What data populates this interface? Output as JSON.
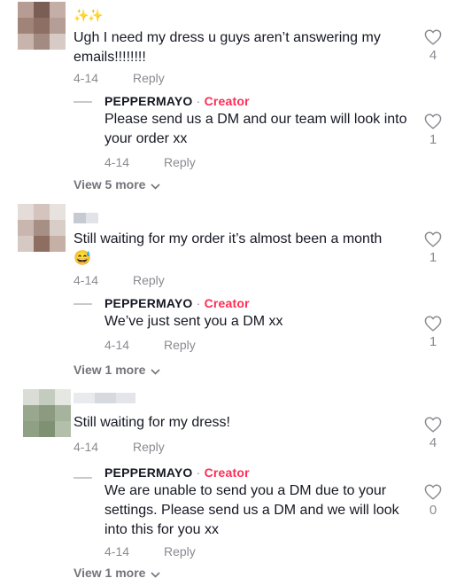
{
  "comments": [
    {
      "prefix_emoji": "✨✨",
      "text": "Ugh I need my dress u guys aren’t answering my emails!!!!!!!!",
      "date": "4-14",
      "reply_label": "Reply",
      "likes": "4",
      "creator_reply": {
        "name": "PEPPERMAYO",
        "separator": "·",
        "badge": "Creator",
        "text": "Please send us a DM and our team will look into your order xx",
        "date": "4-14",
        "reply_label": "Reply",
        "likes": "1"
      },
      "view_more": "View 5 more"
    },
    {
      "text": "Still waiting for my order it’s almost been a month",
      "emoji": "😅",
      "date": "4-14",
      "reply_label": "Reply",
      "likes": "1",
      "creator_reply": {
        "name": "PEPPERMAYO",
        "separator": "·",
        "badge": "Creator",
        "text": "We’ve just sent you a DM xx",
        "date": "4-14",
        "reply_label": "Reply",
        "likes": "1"
      },
      "view_more": "View 1 more"
    },
    {
      "text": "Still waiting for my dress!",
      "date": "4-14",
      "reply_label": "Reply",
      "likes": "4",
      "creator_reply": {
        "name": "PEPPERMAYO",
        "separator": "·",
        "badge": "Creator",
        "text": "We are unable to send you a DM due to your settings. Please send us a DM and we will look into this for you xx",
        "date": "4-14",
        "reply_label": "Reply",
        "likes": "0"
      },
      "view_more": "View 1 more"
    }
  ],
  "colors": {
    "creator_badge": "#fe2c55",
    "meta_text": "#8a8b91",
    "primary_text": "#161823"
  },
  "icons": {
    "like": "heart-outline-icon",
    "expand": "chevron-down-icon"
  }
}
